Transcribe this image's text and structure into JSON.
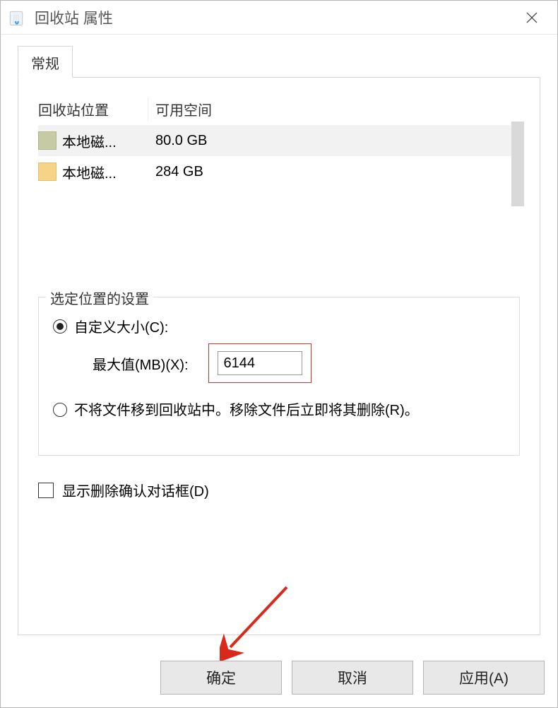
{
  "titlebar": {
    "title": "回收站 属性"
  },
  "tabs": {
    "general": "常规"
  },
  "list": {
    "header_location": "回收站位置",
    "header_space": "可用空间",
    "rows": [
      {
        "name": "本地磁...",
        "space": "80.0 GB"
      },
      {
        "name": "本地磁...",
        "space": "284 GB"
      }
    ]
  },
  "group": {
    "legend": "选定位置的设置",
    "custom_size_label": "自定义大小(C):",
    "max_label": "最大值(MB)(X):",
    "max_value": "6144",
    "no_recycle_label": "不将文件移到回收站中。移除文件后立即将其删除(R)。"
  },
  "confirm_checkbox": "显示删除确认对话框(D)",
  "buttons": {
    "ok": "确定",
    "cancel": "取消",
    "apply": "应用(A)"
  }
}
